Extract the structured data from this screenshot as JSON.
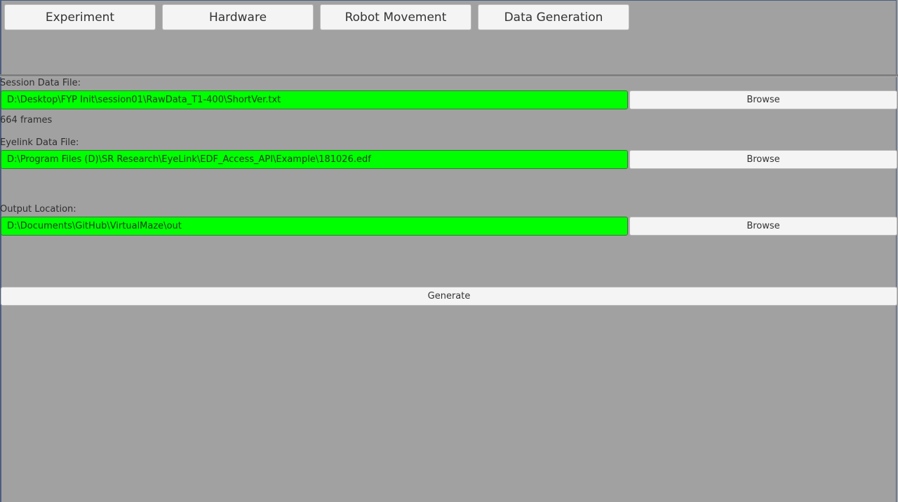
{
  "tabs": [
    {
      "label": "Experiment"
    },
    {
      "label": "Hardware"
    },
    {
      "label": "Robot Movement"
    },
    {
      "label": "Data Generation"
    }
  ],
  "session": {
    "label": "Session Data File:",
    "path": "D:\\Desktop\\FYP Init\\session01\\RawData_T1-400\\ShortVer.txt",
    "browse_label": "Browse",
    "frames_text": "664 frames"
  },
  "eyelink": {
    "label": "Eyelink Data File:",
    "path": "D:\\Program Files (D)\\SR Research\\EyeLink\\EDF_Access_API\\Example\\181026.edf",
    "browse_label": "Browse"
  },
  "output": {
    "label": "Output Location:",
    "path": "D:\\Documents\\GitHub\\VirtualMaze\\out",
    "browse_label": "Browse"
  },
  "generate_label": "Generate",
  "colors": {
    "background": "#a1a1a1",
    "field_valid": "#00ff00",
    "button": "#f4f4f4"
  }
}
